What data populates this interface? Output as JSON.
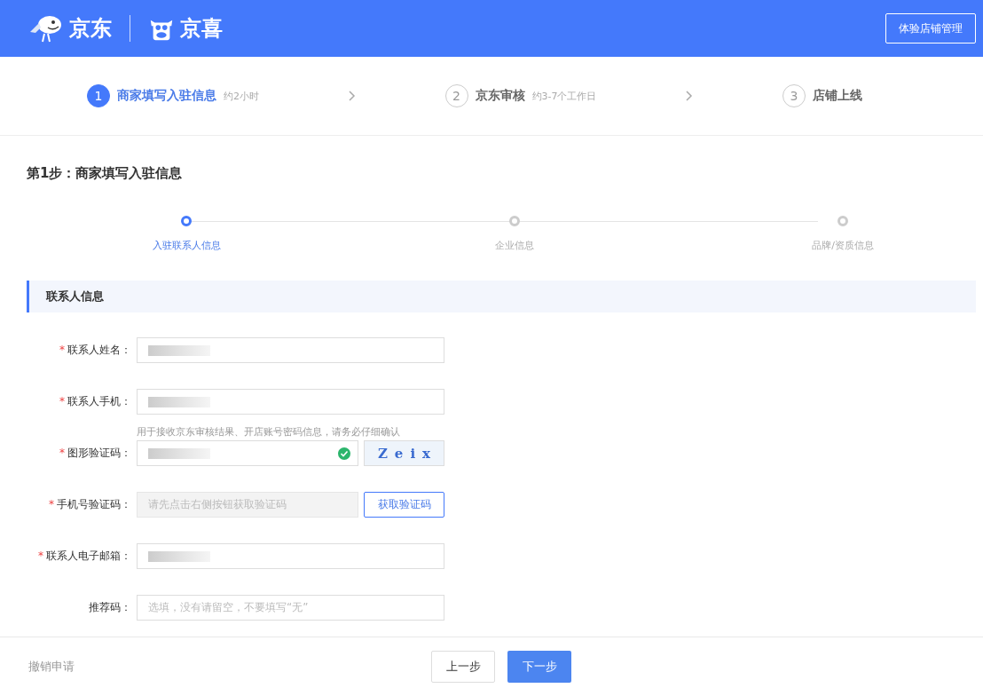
{
  "header": {
    "brand": "京东",
    "sub_brand": "京喜",
    "button": "体验店铺管理"
  },
  "steps": [
    {
      "number": "1",
      "title": "商家填写入驻信息",
      "note": "约2小时",
      "selected": true
    },
    {
      "number": "2",
      "title": "京东审核",
      "note": "约3-7个工作日",
      "selected": false
    },
    {
      "number": "3",
      "title": "店铺上线",
      "selected": false
    }
  ],
  "page_title": "第1步：商家填写入驻信息",
  "substeps": [
    {
      "label": "入驻联系人信息",
      "selected": true
    },
    {
      "label": "企业信息",
      "selected": false
    },
    {
      "label": "品牌/资质信息",
      "selected": false
    }
  ],
  "section_title": "联系人信息",
  "fields": [
    {
      "kind": "text",
      "required_mark": "*",
      "label": "联系人姓名：",
      "redacted": true
    },
    {
      "kind": "text",
      "required_mark": "*",
      "label": "联系人手机：",
      "redacted": true,
      "hint": "用于接收京东审核结果、开店账号密码信息，请务必仔细确认"
    },
    {
      "kind": "captcha",
      "required_mark": "*",
      "label": "图形验证码：",
      "redacted": true,
      "valid": true,
      "captcha": "Zeix"
    },
    {
      "kind": "sms",
      "required_mark": "*",
      "label": "手机号验证码：",
      "placeholder": "请先点击右侧按钮获取验证码",
      "button": "获取验证码",
      "disabled": true
    },
    {
      "kind": "text",
      "required_mark": "*",
      "label": "联系人电子邮箱：",
      "redacted": true
    },
    {
      "kind": "text",
      "label": "推荐码：",
      "placeholder": "选填，没有请留空，不要填写“无”"
    }
  ],
  "footer": {
    "cancel": "撤销申请",
    "prev": "上一步",
    "next": "下一步"
  }
}
